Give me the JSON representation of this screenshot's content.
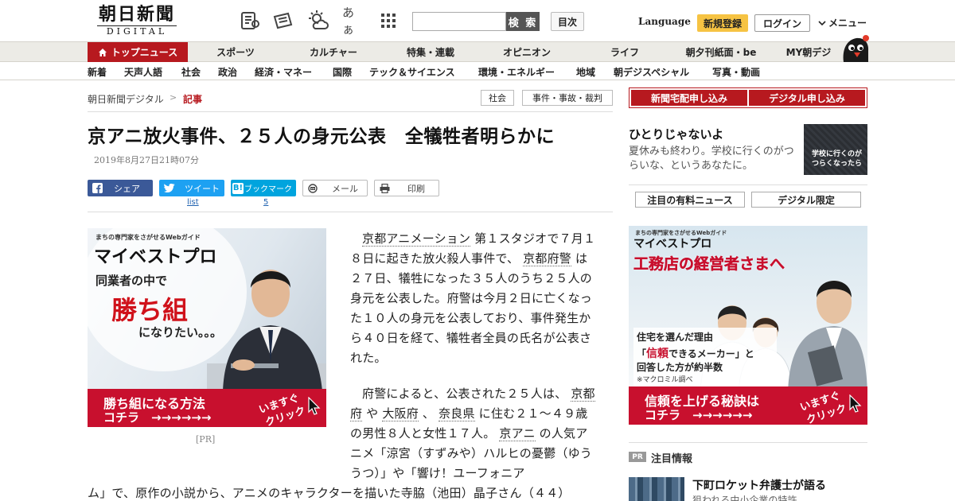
{
  "header": {
    "logo_jp": "朝日新聞",
    "logo_en": "DIGITAL",
    "search_button": "検 索",
    "toc_button": "目次",
    "language": "Language",
    "register": "新規登録",
    "login": "ログイン",
    "menu": "メニュー",
    "font_size_icon_text": "あぁ"
  },
  "main_nav": [
    "トップニュース",
    "スポーツ",
    "カルチャー",
    "特集・連載",
    "オピニオン",
    "ライフ",
    "朝夕刊紙面・be",
    "MY朝デジ"
  ],
  "sub_nav": [
    "新着",
    "天声人語",
    "社会",
    "政治",
    "経済・マネー",
    "国際",
    "テック＆サイエンス",
    "環境・エネルギー",
    "地域",
    "朝デジスペシャル",
    "写真・動画"
  ],
  "breadcrumb": {
    "home": "朝日新聞デジタル",
    "separator": ">",
    "current": "記事"
  },
  "tags": [
    "社会",
    "事件・事故・裁判"
  ],
  "article": {
    "headline": "京アニ放火事件、２５人の身元公表　全犠牲者明らかに",
    "date": "2019年8月27日21時07分",
    "share": {
      "facebook": "シェア",
      "twitter": "ツイート",
      "twitter_count": "list",
      "hatena": "ブックマーク",
      "hatena_count": "5",
      "mail": "メール",
      "print": "印刷"
    },
    "p1": {
      "kw1": "京都アニメーション",
      "t1": " 第１スタジオで７月１８日に起きた放火殺人事件で、 ",
      "kw2": "京都府警",
      "t2": " は２７日、犠牲になった３５人のうち２５人の身元を公表した。府警は今月２日に亡くなった１０人の身元を公表しており、事件発生から４０日を経て、犠牲者全員の氏名が公表された。"
    },
    "p2": {
      "t1": "府警によると、公表された２５人は、 ",
      "kw1": "京都府",
      "t2": " や ",
      "kw2": "大阪府",
      "t3": " 、 ",
      "kw3": "奈良県",
      "t4": " に住む２１～４９歳の男性８人と女性１７人。 ",
      "kw4": "京アニ",
      "t5": " の人気アニメ「涼宮（すずみや）ハルヒの憂鬱（ゆううつ）」や「響け！ユーフォニア",
      "t6": "ム」で、原作の小説から、アニメのキャラクターを描いた寺脇（池田）晶子さん（４４）"
    },
    "pr_label": "[PR]"
  },
  "ad_left": {
    "tagline": "まちの専門家をさがせるWebガイド",
    "brand": "マイベストプロ",
    "line1": "同業者の中で",
    "line2": "勝ち組",
    "line3": "になりたい。。。",
    "cta1": "勝ち組になる方法",
    "cta2": "コチラ　→→→→→→",
    "cta3": "いますぐ",
    "cta4": "クリック"
  },
  "right": {
    "apply_paper": "新聞宅配申し込み",
    "apply_digital": "デジタル申し込み",
    "promo_title": "ひとりじゃないよ",
    "promo_text": "夏休みも終わり。学校に行くのがつらいな、というあなたに。",
    "promo_img_text1": "学校に行くのが",
    "promo_img_text2": "つらくなったら",
    "tab_paid": "注目の有料ニュース",
    "tab_digital": "デジタル限定",
    "pr_badge": "PR",
    "notice_title": "注目情報",
    "notice_head": "下町ロケット弁護士が語る",
    "notice_sub": "狙われる中小企業の特許"
  },
  "ad_right": {
    "tagline": "まちの専門家をさがせるWebガイド",
    "brand": "マイベストプロ",
    "headline": "工務店の経営者さまへ",
    "line1": "住宅を選んだ理由",
    "line2a": "「",
    "line2b": "信頼",
    "line2c": "できるメーカー」と",
    "line3": "回答した方が約半数",
    "line4": "※マクロミル調べ",
    "cta1": "信頼を上げる秘訣は",
    "cta2": "コチラ　→→→→→→",
    "cta3": "いますぐ",
    "cta4": "クリック"
  },
  "colors": {
    "brand_red": "#b7191f",
    "register_yellow": "#f6c343",
    "facebook": "#3b5998",
    "twitter": "#1da1f2",
    "hatena": "#00a4de"
  }
}
